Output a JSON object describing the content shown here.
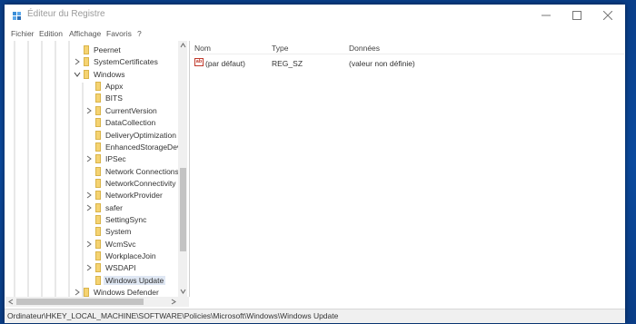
{
  "window": {
    "title": "Éditeur du Registre",
    "icon": "regedit-icon"
  },
  "controls": {
    "minimize_icon": "minimize-icon",
    "maximize_icon": "maximize-icon",
    "close_icon": "close-icon"
  },
  "menu": [
    "Fichier",
    "Edition",
    "Affichage",
    "Favoris",
    "?"
  ],
  "tree": {
    "items": [
      {
        "label": "Peernet",
        "expandable": false
      },
      {
        "label": "SystemCertificates",
        "expandable": true
      },
      {
        "label": "Windows",
        "expandable": true,
        "expanded": true
      },
      {
        "label": "Appx",
        "expandable": false
      },
      {
        "label": "BITS",
        "expandable": false
      },
      {
        "label": "CurrentVersion",
        "expandable": true
      },
      {
        "label": "DataCollection",
        "expandable": false
      },
      {
        "label": "DeliveryOptimization",
        "expandable": false
      },
      {
        "label": "EnhancedStorageDev",
        "expandable": false
      },
      {
        "label": "IPSec",
        "expandable": true
      },
      {
        "label": "Network Connections",
        "expandable": false
      },
      {
        "label": "NetworkConnectivity",
        "expandable": false
      },
      {
        "label": "NetworkProvider",
        "expandable": true
      },
      {
        "label": "safer",
        "expandable": true
      },
      {
        "label": "SettingSync",
        "expandable": false
      },
      {
        "label": "System",
        "expandable": false
      },
      {
        "label": "WcmSvc",
        "expandable": true
      },
      {
        "label": "WorkplaceJoin",
        "expandable": false
      },
      {
        "label": "WSDAPI",
        "expandable": true
      },
      {
        "label": "Windows Update",
        "expandable": false,
        "selected": true
      },
      {
        "label": "Windows Defender",
        "expandable": true
      }
    ]
  },
  "list": {
    "columns": [
      "Nom",
      "Type",
      "Données"
    ],
    "rows": [
      {
        "name": "(par défaut)",
        "type": "REG_SZ",
        "data": "(valeur non définie)",
        "icon": "ab"
      }
    ]
  },
  "status": {
    "path": "Ordinateur\\HKEY_LOCAL_MACHINE\\SOFTWARE\\Policies\\Microsoft\\Windows\\Windows Update"
  },
  "colors": {
    "folder": "#f5d372",
    "selection": "#dfe7f3",
    "desktop": "#0b4a9e"
  }
}
